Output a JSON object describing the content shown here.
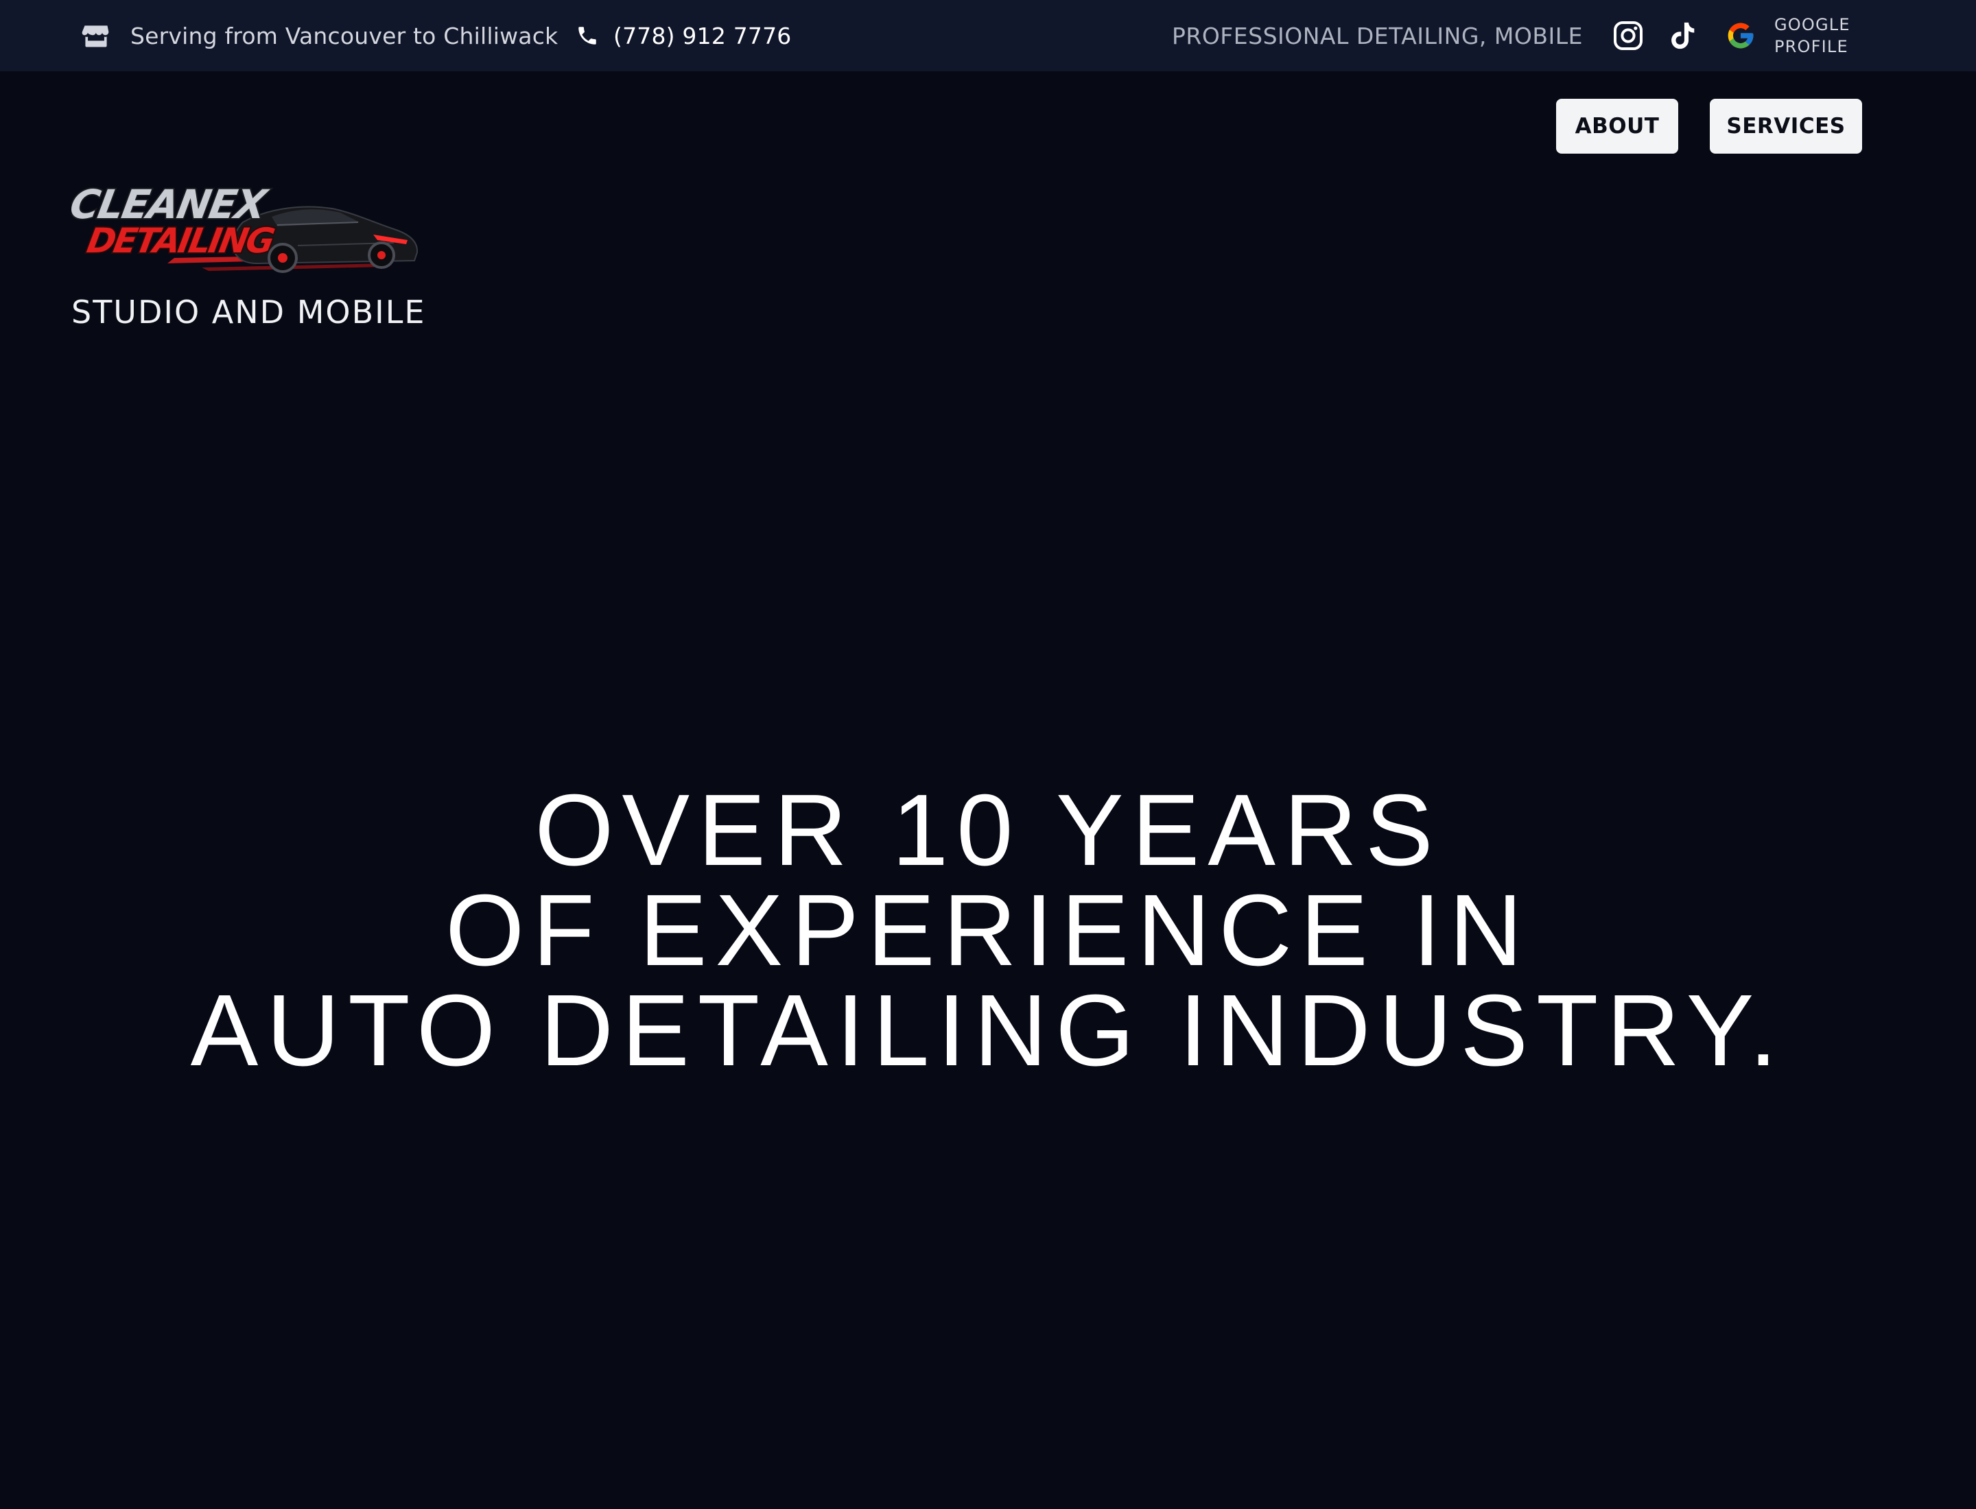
{
  "topbar": {
    "location": "Serving from Vancouver to Chilliwack",
    "phone": "(778) 912 7776",
    "tagline": "PROFESSIONAL DETAILING, MOBILE",
    "social": {
      "instagram_icon": "instagram-icon",
      "tiktok_icon": "tiktok-icon",
      "google_icon": "google-icon",
      "google_label_line1": "GOOGLE",
      "google_label_line2": "PROFILE"
    },
    "icons": {
      "location": "store-icon",
      "phone": "phone-icon"
    }
  },
  "nav": {
    "about": "ABOUT",
    "services": "SERVICES"
  },
  "brand": {
    "logo_line1": "CLEANEX",
    "logo_line2": "DETAILING",
    "subtitle": "STUDIO AND MOBILE",
    "colors": {
      "logo_red": "#e01e1e",
      "logo_silver": "#c9ccd3"
    }
  },
  "hero": {
    "line1": "OVER 10 YEARS",
    "line2": "OF EXPERIENCE IN",
    "line3": "AUTO DETAILING INDUSTRY."
  },
  "colors": {
    "background": "#070914",
    "topbar": "#11172a",
    "button_bg": "#f3f4f6",
    "button_text": "#0b0d17"
  }
}
